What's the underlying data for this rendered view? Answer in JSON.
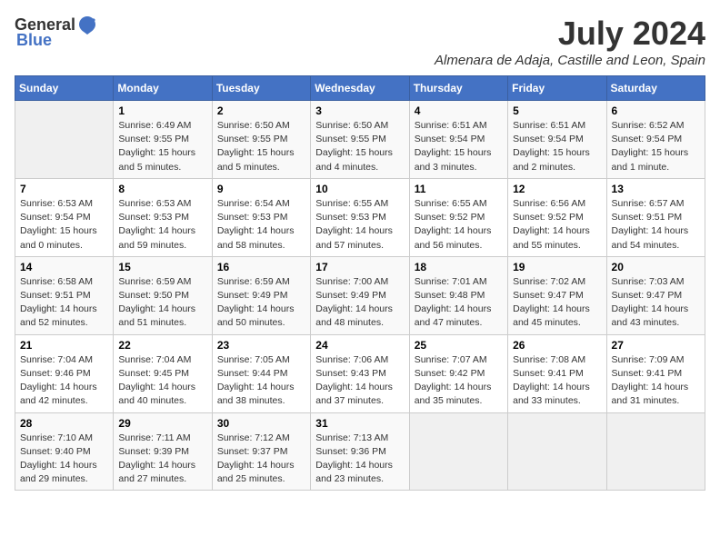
{
  "header": {
    "logo_general": "General",
    "logo_blue": "Blue",
    "month": "July 2024",
    "location": "Almenara de Adaja, Castille and Leon, Spain"
  },
  "weekdays": [
    "Sunday",
    "Monday",
    "Tuesday",
    "Wednesday",
    "Thursday",
    "Friday",
    "Saturday"
  ],
  "weeks": [
    [
      {
        "day": "",
        "sunrise": "",
        "sunset": "",
        "daylight": ""
      },
      {
        "day": "1",
        "sunrise": "Sunrise: 6:49 AM",
        "sunset": "Sunset: 9:55 PM",
        "daylight": "Daylight: 15 hours and 5 minutes."
      },
      {
        "day": "2",
        "sunrise": "Sunrise: 6:50 AM",
        "sunset": "Sunset: 9:55 PM",
        "daylight": "Daylight: 15 hours and 5 minutes."
      },
      {
        "day": "3",
        "sunrise": "Sunrise: 6:50 AM",
        "sunset": "Sunset: 9:55 PM",
        "daylight": "Daylight: 15 hours and 4 minutes."
      },
      {
        "day": "4",
        "sunrise": "Sunrise: 6:51 AM",
        "sunset": "Sunset: 9:54 PM",
        "daylight": "Daylight: 15 hours and 3 minutes."
      },
      {
        "day": "5",
        "sunrise": "Sunrise: 6:51 AM",
        "sunset": "Sunset: 9:54 PM",
        "daylight": "Daylight: 15 hours and 2 minutes."
      },
      {
        "day": "6",
        "sunrise": "Sunrise: 6:52 AM",
        "sunset": "Sunset: 9:54 PM",
        "daylight": "Daylight: 15 hours and 1 minute."
      }
    ],
    [
      {
        "day": "7",
        "sunrise": "Sunrise: 6:53 AM",
        "sunset": "Sunset: 9:54 PM",
        "daylight": "Daylight: 15 hours and 0 minutes."
      },
      {
        "day": "8",
        "sunrise": "Sunrise: 6:53 AM",
        "sunset": "Sunset: 9:53 PM",
        "daylight": "Daylight: 14 hours and 59 minutes."
      },
      {
        "day": "9",
        "sunrise": "Sunrise: 6:54 AM",
        "sunset": "Sunset: 9:53 PM",
        "daylight": "Daylight: 14 hours and 58 minutes."
      },
      {
        "day": "10",
        "sunrise": "Sunrise: 6:55 AM",
        "sunset": "Sunset: 9:53 PM",
        "daylight": "Daylight: 14 hours and 57 minutes."
      },
      {
        "day": "11",
        "sunrise": "Sunrise: 6:55 AM",
        "sunset": "Sunset: 9:52 PM",
        "daylight": "Daylight: 14 hours and 56 minutes."
      },
      {
        "day": "12",
        "sunrise": "Sunrise: 6:56 AM",
        "sunset": "Sunset: 9:52 PM",
        "daylight": "Daylight: 14 hours and 55 minutes."
      },
      {
        "day": "13",
        "sunrise": "Sunrise: 6:57 AM",
        "sunset": "Sunset: 9:51 PM",
        "daylight": "Daylight: 14 hours and 54 minutes."
      }
    ],
    [
      {
        "day": "14",
        "sunrise": "Sunrise: 6:58 AM",
        "sunset": "Sunset: 9:51 PM",
        "daylight": "Daylight: 14 hours and 52 minutes."
      },
      {
        "day": "15",
        "sunrise": "Sunrise: 6:59 AM",
        "sunset": "Sunset: 9:50 PM",
        "daylight": "Daylight: 14 hours and 51 minutes."
      },
      {
        "day": "16",
        "sunrise": "Sunrise: 6:59 AM",
        "sunset": "Sunset: 9:49 PM",
        "daylight": "Daylight: 14 hours and 50 minutes."
      },
      {
        "day": "17",
        "sunrise": "Sunrise: 7:00 AM",
        "sunset": "Sunset: 9:49 PM",
        "daylight": "Daylight: 14 hours and 48 minutes."
      },
      {
        "day": "18",
        "sunrise": "Sunrise: 7:01 AM",
        "sunset": "Sunset: 9:48 PM",
        "daylight": "Daylight: 14 hours and 47 minutes."
      },
      {
        "day": "19",
        "sunrise": "Sunrise: 7:02 AM",
        "sunset": "Sunset: 9:47 PM",
        "daylight": "Daylight: 14 hours and 45 minutes."
      },
      {
        "day": "20",
        "sunrise": "Sunrise: 7:03 AM",
        "sunset": "Sunset: 9:47 PM",
        "daylight": "Daylight: 14 hours and 43 minutes."
      }
    ],
    [
      {
        "day": "21",
        "sunrise": "Sunrise: 7:04 AM",
        "sunset": "Sunset: 9:46 PM",
        "daylight": "Daylight: 14 hours and 42 minutes."
      },
      {
        "day": "22",
        "sunrise": "Sunrise: 7:04 AM",
        "sunset": "Sunset: 9:45 PM",
        "daylight": "Daylight: 14 hours and 40 minutes."
      },
      {
        "day": "23",
        "sunrise": "Sunrise: 7:05 AM",
        "sunset": "Sunset: 9:44 PM",
        "daylight": "Daylight: 14 hours and 38 minutes."
      },
      {
        "day": "24",
        "sunrise": "Sunrise: 7:06 AM",
        "sunset": "Sunset: 9:43 PM",
        "daylight": "Daylight: 14 hours and 37 minutes."
      },
      {
        "day": "25",
        "sunrise": "Sunrise: 7:07 AM",
        "sunset": "Sunset: 9:42 PM",
        "daylight": "Daylight: 14 hours and 35 minutes."
      },
      {
        "day": "26",
        "sunrise": "Sunrise: 7:08 AM",
        "sunset": "Sunset: 9:41 PM",
        "daylight": "Daylight: 14 hours and 33 minutes."
      },
      {
        "day": "27",
        "sunrise": "Sunrise: 7:09 AM",
        "sunset": "Sunset: 9:41 PM",
        "daylight": "Daylight: 14 hours and 31 minutes."
      }
    ],
    [
      {
        "day": "28",
        "sunrise": "Sunrise: 7:10 AM",
        "sunset": "Sunset: 9:40 PM",
        "daylight": "Daylight: 14 hours and 29 minutes."
      },
      {
        "day": "29",
        "sunrise": "Sunrise: 7:11 AM",
        "sunset": "Sunset: 9:39 PM",
        "daylight": "Daylight: 14 hours and 27 minutes."
      },
      {
        "day": "30",
        "sunrise": "Sunrise: 7:12 AM",
        "sunset": "Sunset: 9:37 PM",
        "daylight": "Daylight: 14 hours and 25 minutes."
      },
      {
        "day": "31",
        "sunrise": "Sunrise: 7:13 AM",
        "sunset": "Sunset: 9:36 PM",
        "daylight": "Daylight: 14 hours and 23 minutes."
      },
      {
        "day": "",
        "sunrise": "",
        "sunset": "",
        "daylight": ""
      },
      {
        "day": "",
        "sunrise": "",
        "sunset": "",
        "daylight": ""
      },
      {
        "day": "",
        "sunrise": "",
        "sunset": "",
        "daylight": ""
      }
    ]
  ]
}
